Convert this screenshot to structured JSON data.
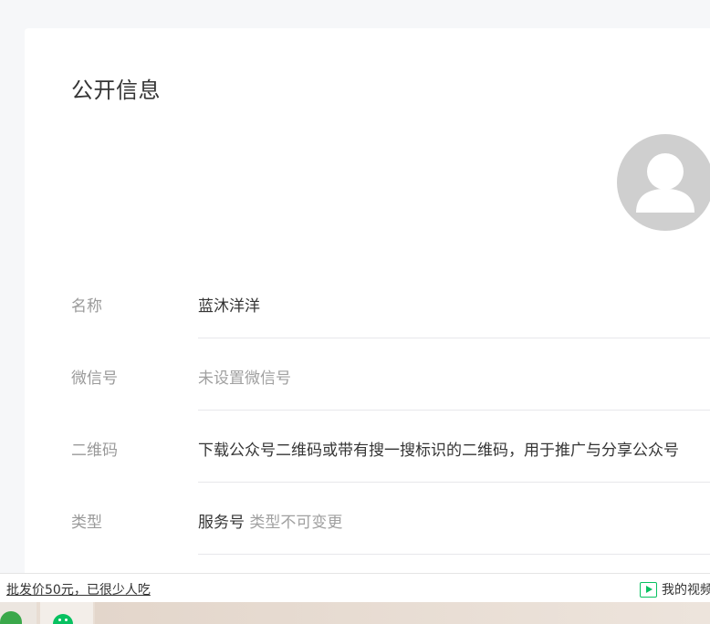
{
  "public_info": {
    "title": "公开信息",
    "rows": [
      {
        "label": "名称",
        "value": "蓝沐洋洋"
      },
      {
        "label": "微信号",
        "value": "未设置微信号"
      },
      {
        "label": "二维码",
        "value": "下载公众号二维码或带有搜一搜标识的二维码，用于推广与分享公众号"
      },
      {
        "label": "类型",
        "value": "服务号",
        "note": "类型不可变更"
      }
    ]
  },
  "footer": {
    "ad_text": "批发价50元，已很少人吃",
    "video_label": "我的视频"
  },
  "colors": {
    "accent_green": "#07c160",
    "label_gray": "#9a9a9a",
    "divider": "#e7e7eb"
  }
}
